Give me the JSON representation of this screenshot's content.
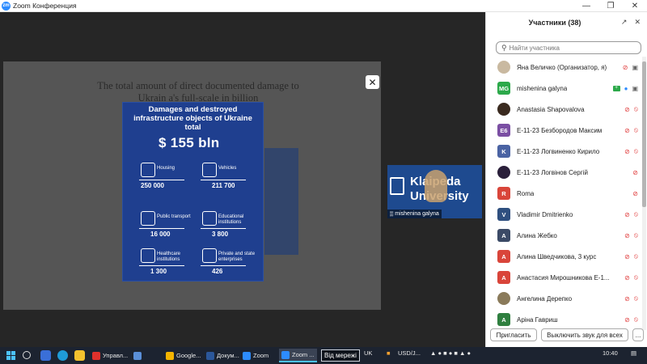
{
  "window": {
    "title": "Zoom Конференция",
    "logo": "zm"
  },
  "share": {
    "slide_text": "The total amount of direct documented damage to Ukrain                              a's full-scale in                                            billion",
    "infographic": {
      "title": "Damages and destroyed infrastructure objects of Ukraine total",
      "total": "$ 155 bln",
      "cells": [
        {
          "label": "Housing",
          "value": "250 000",
          "icon": "house-icon"
        },
        {
          "label": "Vehicles",
          "value": "211 700",
          "icon": "car-icon"
        },
        {
          "label": "Public transport",
          "value": "16 000",
          "icon": "bus-icon"
        },
        {
          "label": "Educational institutions",
          "value": "3 800",
          "icon": "school-icon"
        },
        {
          "label": "Healthcare institutions",
          "value": "1 300",
          "icon": "heart-pulse-icon"
        },
        {
          "label": "Private and state enterprises",
          "value": "426",
          "icon": "factory-icon"
        }
      ]
    }
  },
  "video": {
    "brand_line1": "Klaipeda",
    "brand_line2": "University",
    "name": "mishenina galyna"
  },
  "panel": {
    "title": "Участники (38)",
    "search_placeholder": "Найти участника",
    "participants": [
      {
        "name": "Яна Величко (Организатор, я)",
        "initials": "",
        "color": "#c9b9a0",
        "photo": true,
        "mic": "off",
        "cam": "on"
      },
      {
        "name": "mishenina galyna",
        "initials": "MG",
        "color": "#2ca94a",
        "photo": false,
        "mic": "on",
        "cam": "on",
        "sharing": true
      },
      {
        "name": "Anastasia Shapovalova",
        "initials": "",
        "color": "#3a2a1f",
        "photo": true,
        "mic": "off",
        "cam": "off"
      },
      {
        "name": "E-11-23 Безбородов Максим",
        "initials": "Е6",
        "color": "#7b4fa3",
        "photo": false,
        "mic": "off",
        "cam": "off"
      },
      {
        "name": "E-11-23 Логвиненко Кирило",
        "initials": "K",
        "color": "#4a63a3",
        "photo": false,
        "mic": "off",
        "cam": "off"
      },
      {
        "name": "E-11-23 Логвінов Сергій",
        "initials": "",
        "color": "#2a1f3a",
        "photo": true,
        "mic": "off",
        "cam": "none"
      },
      {
        "name": "Roma",
        "initials": "R",
        "color": "#d9453a",
        "photo": false,
        "mic": "off",
        "cam": "none"
      },
      {
        "name": "Vladimir Dmitrienko",
        "initials": "V",
        "color": "#2f4f7f",
        "photo": false,
        "mic": "off",
        "cam": "off"
      },
      {
        "name": "Алина Жебко",
        "initials": "A",
        "color": "#3b4a66",
        "photo": false,
        "mic": "off",
        "cam": "off"
      },
      {
        "name": "Алина Шведчикова, 3 курс",
        "initials": "A",
        "color": "#d9453a",
        "photo": false,
        "mic": "off",
        "cam": "off"
      },
      {
        "name": "Анастасия Мирошникова Е-1...",
        "initials": "A",
        "color": "#d9453a",
        "photo": false,
        "mic": "off",
        "cam": "off"
      },
      {
        "name": "Ангелина Дерепко",
        "initials": "",
        "color": "#8a7a5a",
        "photo": true,
        "mic": "off",
        "cam": "off"
      },
      {
        "name": "Аріна Гавриш",
        "initials": "A",
        "color": "#2f7f3f",
        "photo": false,
        "mic": "off",
        "cam": "off"
      }
    ],
    "invite_label": "Пригласить",
    "mute_all_label": "Выключить звук для всех",
    "more_label": "..."
  },
  "taskbar": {
    "apps": [
      {
        "label": "Управл...",
        "color": "#e0312c"
      },
      {
        "label": "",
        "color": "#5a8fd8"
      },
      {
        "label": "Google...",
        "color": "#f4b400"
      },
      {
        "label": "Докум...",
        "color": "#2b579a"
      },
      {
        "label": "Zoom",
        "color": "#2d8cff"
      },
      {
        "label": "Zoom ...",
        "color": "#2d8cff"
      }
    ],
    "network_text": "Від мережі",
    "lang": "UK",
    "ticker": "USD/J...",
    "time": "10:40"
  }
}
